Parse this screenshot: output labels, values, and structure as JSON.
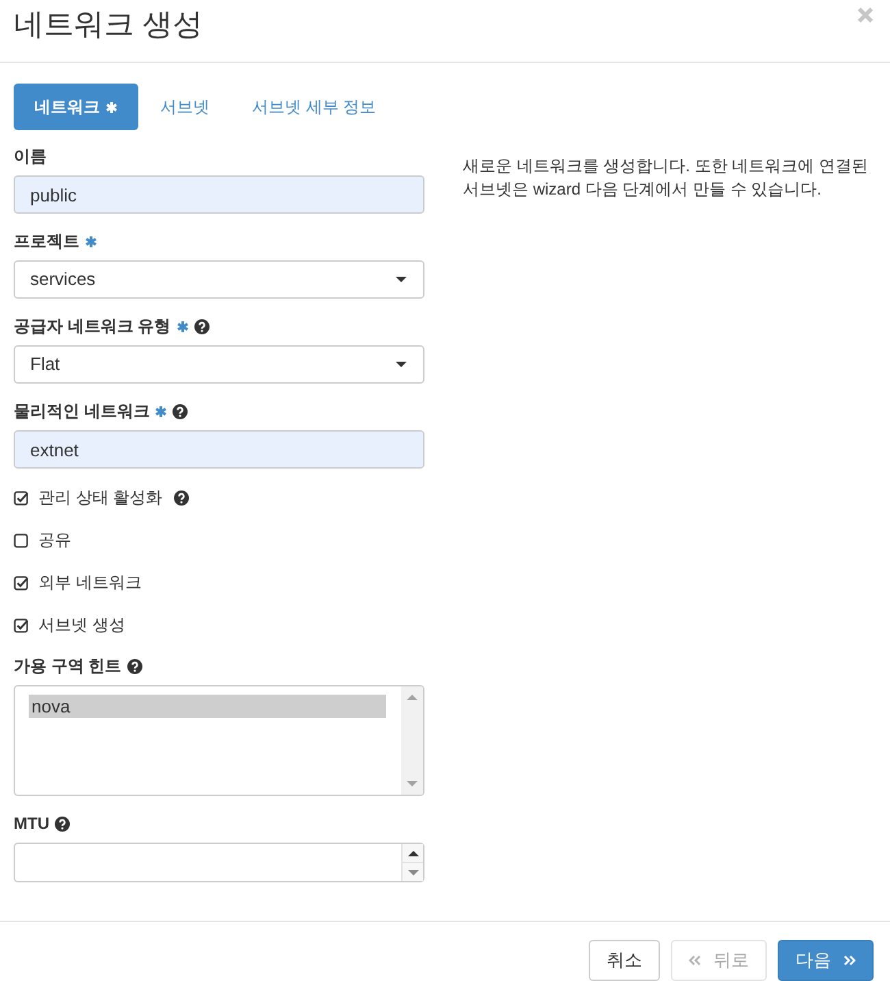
{
  "dialog": {
    "title": "네트워크 생성"
  },
  "tabs": [
    {
      "label": "네트워크",
      "required": true,
      "selected": true
    },
    {
      "label": "서브넷",
      "required": false,
      "selected": false
    },
    {
      "label": "서브넷 세부 정보",
      "required": false,
      "selected": false
    }
  ],
  "fields": [
    {
      "kind": "text",
      "label": "이름",
      "required": false,
      "help": false,
      "value": "public",
      "autofilled": true
    },
    {
      "kind": "select",
      "label": "프로젝트",
      "required": true,
      "help": false,
      "value": "services"
    },
    {
      "kind": "select",
      "label": "공급자 네트워크 유형",
      "required": true,
      "help": true,
      "value": "Flat"
    },
    {
      "kind": "text",
      "label": "물리적인 네트워크",
      "required": true,
      "help": true,
      "value": "extnet",
      "autofilled": true
    },
    {
      "kind": "checkbox",
      "label": "관리 상태 활성화",
      "checked": true,
      "help": true
    },
    {
      "kind": "checkbox",
      "label": "공유",
      "checked": false,
      "help": false
    },
    {
      "kind": "checkbox",
      "label": "외부 네트워크",
      "checked": true,
      "help": false
    },
    {
      "kind": "checkbox",
      "label": "서브넷 생성",
      "checked": true,
      "help": false
    },
    {
      "kind": "listbox",
      "label": "가용 구역 힌트",
      "required": false,
      "help": true,
      "options": [
        {
          "label": "nova",
          "selected": true
        }
      ]
    },
    {
      "kind": "number",
      "label": "MTU",
      "required": false,
      "help": true
    }
  ],
  "description": "새로운 네트워크를 생성합니다. 또한 네트워크에 연결된 서브넷은 wizard 다음 단계에서 만들 수 있습니다.",
  "buttons": [
    {
      "kind": "cancel",
      "label": "취소",
      "disabled": false
    },
    {
      "kind": "back",
      "label": "뒤로",
      "disabled": true
    },
    {
      "kind": "next",
      "label": "다음",
      "disabled": false
    }
  ]
}
